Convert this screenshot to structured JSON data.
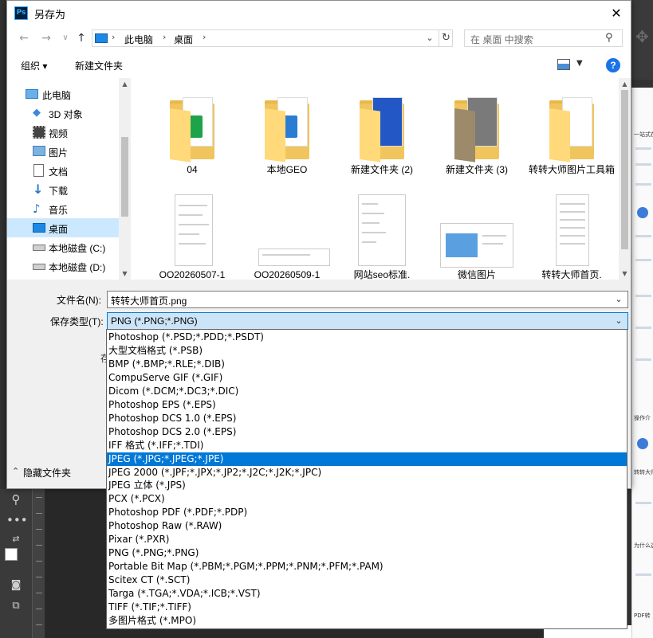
{
  "dialog": {
    "title": "另存为",
    "app_logo": "Ps"
  },
  "nav": {
    "back_icon": "←",
    "forward_icon": "→",
    "recent_icon": "∨",
    "up_icon": "↑",
    "breadcrumb": [
      "此电脑",
      "桌面"
    ],
    "search_placeholder": "在 桌面 中搜索"
  },
  "toolbar": {
    "organize_label": "组织 ▾",
    "new_folder_label": "新建文件夹",
    "help_label": "?"
  },
  "sidebar": {
    "items": [
      {
        "label": "此电脑",
        "icon": "pc-icon"
      },
      {
        "label": "3D 对象",
        "icon": "cube-icon"
      },
      {
        "label": "视频",
        "icon": "video-icon"
      },
      {
        "label": "图片",
        "icon": "pictures-icon"
      },
      {
        "label": "文档",
        "icon": "documents-icon"
      },
      {
        "label": "下载",
        "icon": "download-icon"
      },
      {
        "label": "音乐",
        "icon": "music-icon"
      },
      {
        "label": "桌面",
        "icon": "desktop-icon"
      },
      {
        "label": "本地磁盘 (C:)",
        "icon": "drive-icon"
      },
      {
        "label": "本地磁盘 (D:)",
        "icon": "drive-icon"
      }
    ],
    "selected_index": 7
  },
  "files": {
    "row1": [
      {
        "name": "04",
        "kind": "folder"
      },
      {
        "name": "本地GEO",
        "kind": "folder"
      },
      {
        "name": "新建文件夹 (2)",
        "kind": "folder"
      },
      {
        "name": "新建文件夹 (3)",
        "kind": "folder"
      },
      {
        "name": "转转大师图片工具箱",
        "kind": "folder"
      }
    ],
    "row2": [
      {
        "name": "OO20260507-1",
        "kind": "image"
      },
      {
        "name": "OO20260509-1",
        "kind": "image"
      },
      {
        "name": "网站seo标准.",
        "kind": "image"
      },
      {
        "name": "微信图片",
        "kind": "image"
      },
      {
        "name": "转转大师首页.",
        "kind": "image"
      }
    ]
  },
  "form": {
    "filename_label": "文件名(N):",
    "filename_value": "转转大师首页.png",
    "filetype_label": "保存类型(T):",
    "filetype_value": "PNG (*.PNG;*.PNG)",
    "partial_label": "存",
    "hide_folders_label": "隐藏文件夹"
  },
  "filetype_options": [
    "Photoshop (*.PSD;*.PDD;*.PSDT)",
    "大型文档格式 (*.PSB)",
    "BMP (*.BMP;*.RLE;*.DIB)",
    "CompuServe GIF (*.GIF)",
    "Dicom (*.DCM;*.DC3;*.DIC)",
    "Photoshop EPS (*.EPS)",
    "Photoshop DCS 1.0 (*.EPS)",
    "Photoshop DCS 2.0 (*.EPS)",
    "IFF 格式 (*.IFF;*.TDI)",
    "JPEG (*.JPG;*.JPEG;*.JPE)",
    "JPEG 2000 (*.JPF;*.JPX;*.JP2;*.J2C;*.J2K;*.JPC)",
    "JPEG 立体 (*.JPS)",
    "PCX (*.PCX)",
    "Photoshop PDF (*.PDF;*.PDP)",
    "Photoshop Raw (*.RAW)",
    "Pixar (*.PXR)",
    "PNG (*.PNG;*.PNG)",
    "Portable Bit Map (*.PBM;*.PGM;*.PPM;*.PNM;*.PFM;*.PAM)",
    "Scitex CT (*.SCT)",
    "Targa (*.TGA;*.VDA;*.ICB;*.VST)",
    "TIFF (*.TIF;*.TIFF)",
    "多图片格式 (*.MPO)"
  ],
  "filetype_highlighted_index": 9,
  "background_panel": {
    "labels": [
      "一站式在线",
      "操作介",
      "转转大师",
      "为什么选",
      "PDF转"
    ]
  },
  "colors": {
    "accent": "#0078d7",
    "selection": "#cce8ff",
    "folder": "#f0c55d"
  }
}
